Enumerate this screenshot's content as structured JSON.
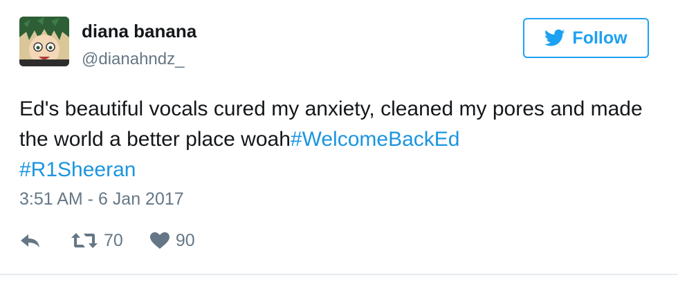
{
  "user": {
    "display_name": "diana banana",
    "handle": "@dianahndz_"
  },
  "follow_button": {
    "label": "Follow",
    "icon": "twitter-bird-icon"
  },
  "tweet": {
    "text_plain": "Ed's beautiful vocals cured my anxiety, cleaned my pores and made the world a better place woah",
    "hashtags": [
      "#WelcomeBackEd",
      "#R1Sheeran"
    ],
    "timestamp": "3:51 AM - 6 Jan 2017"
  },
  "actions": {
    "reply_icon": "reply-icon",
    "retweet_icon": "retweet-icon",
    "retweet_count": "70",
    "like_icon": "heart-icon",
    "like_count": "90"
  },
  "colors": {
    "accent": "#1da1f2",
    "hashtag": "#1b95e0",
    "secondary_text": "#657786",
    "primary_text": "#14171a",
    "border": "#e6ecf0"
  }
}
